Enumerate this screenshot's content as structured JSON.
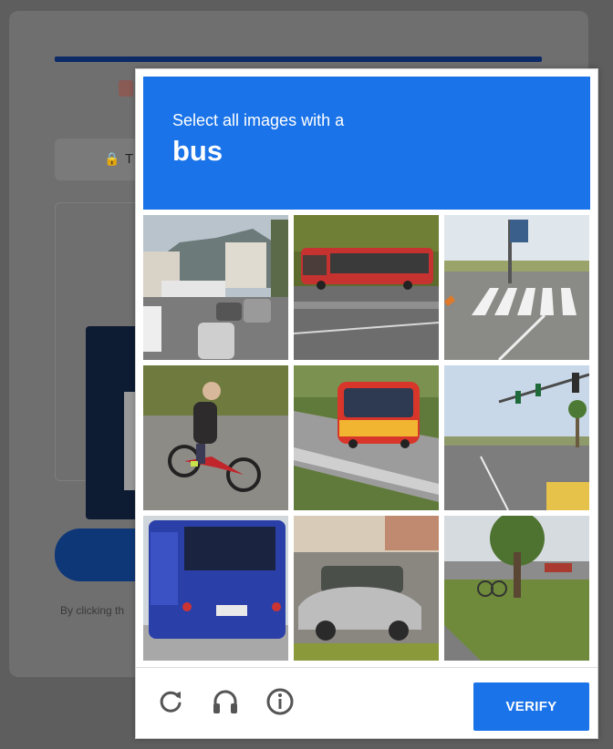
{
  "background": {
    "partial_label": "T",
    "fine_print": "By clicking th"
  },
  "captcha": {
    "instruction": "Select all images with a",
    "target": "bus",
    "tiles": [
      {
        "scene": "street traffic with mountains"
      },
      {
        "scene": "red bus on road"
      },
      {
        "scene": "crosswalk intersection"
      },
      {
        "scene": "man on red bicycle"
      },
      {
        "scene": "red and yellow bus on highway"
      },
      {
        "scene": "traffic light and palm trees"
      },
      {
        "scene": "blue bus rear view"
      },
      {
        "scene": "silver car street"
      },
      {
        "scene": "park with bicycle"
      }
    ],
    "footer": {
      "reload_icon": "reload-icon",
      "audio_icon": "headphones-icon",
      "info_icon": "info-icon",
      "verify_label": "VERIFY"
    }
  },
  "colors": {
    "accent": "#1a73e8",
    "overlay": "#5e5e5e",
    "background_bar": "#0b2a66"
  }
}
